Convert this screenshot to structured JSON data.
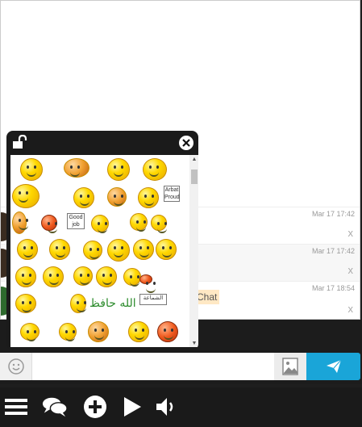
{
  "messages": [
    {
      "time": "Mar 17 17:42",
      "text": "",
      "close": "x"
    },
    {
      "time": "Mar 17 17:42",
      "text": "",
      "close": "x"
    },
    {
      "time": "Mar 17 18:54",
      "text": "Chat",
      "close": "x"
    }
  ],
  "input": {
    "placeholder": "",
    "value": ""
  },
  "emoji_panel": {
    "signs": [
      "Good job",
      "Arbat Proud"
    ],
    "arabic_text": "الله حافظ",
    "arabic_sign": "الشماعة"
  },
  "toolbar": {
    "items": [
      "menu-icon",
      "chat-icon",
      "add-icon",
      "play-icon",
      "volume-icon"
    ]
  },
  "colors": {
    "accent": "#1aa5d8",
    "panel": "#1b1b1b",
    "toolbar": "#1a1a1a"
  }
}
